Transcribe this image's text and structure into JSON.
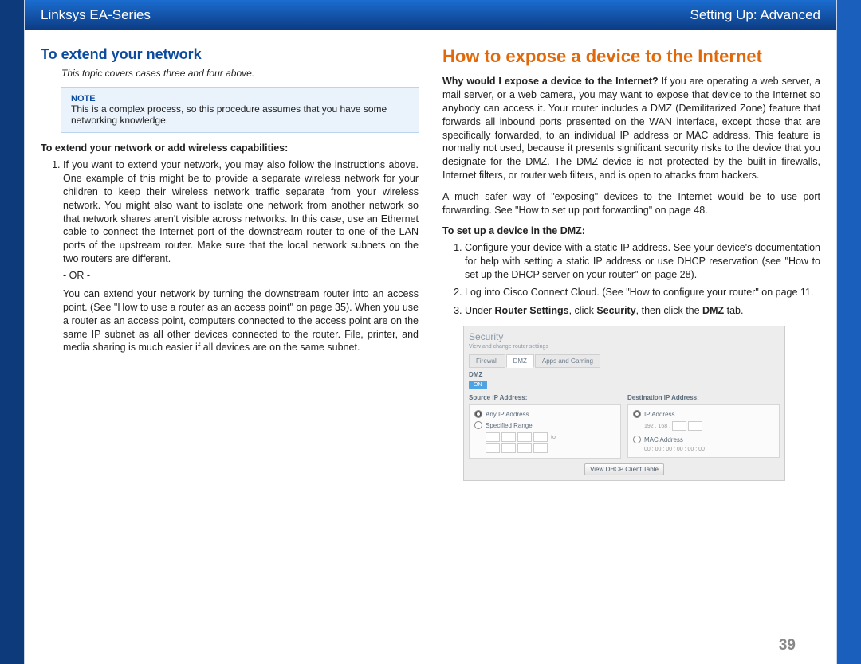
{
  "header": {
    "left": "Linksys EA-Series",
    "right": "Setting Up: Advanced"
  },
  "left": {
    "heading": "To extend your network",
    "subtitle": "This topic covers cases three and four above.",
    "note_label": "NOTE",
    "note_text": "This is a complex process, so this procedure assumes that you have some networking knowledge.",
    "bold_intro": "To extend your network or add wireless capabilities:",
    "step1": "If you want to extend your network, you may also follow the instructions above. One example of this might be to provide a separate wireless network for your children to keep their wireless network traffic separate from your wireless network. You might also want to isolate one network from another network so that network shares aren't visible across networks. In this case, use an Ethernet cable to connect the Internet port of the downstream router to one of the LAN ports of the upstream router. Make sure that the local network subnets on the two routers are different.",
    "or_text": "- OR -",
    "step1b": "You can extend your network by turning the downstream router into an access point. (See \"How to use a router as an access point\" on page 35). When you use a router as an access point, computers connected to the access point are on the same IP subnet as all other devices connected to the router. File, printer, and media sharing is much easier if all devices are on the same subnet."
  },
  "right": {
    "heading": "How to expose a device to the Internet",
    "para1_question": "Why would I expose a device to the Internet?",
    "para1_rest": " If you are operating a web server, a mail server, or a web camera, you may want to expose that device to the Internet so anybody can access it. Your router includes a DMZ (Demilitarized Zone) feature that forwards all inbound ports presented on the WAN interface, except those that are specifically forwarded, to an individual IP address or MAC address. This feature is normally not used, because it presents significant security risks to the device that you designate for the DMZ. The DMZ device is not protected by the built-in firewalls, Internet filters, or router web filters, and is open to attacks from hackers.",
    "para2": "A much safer way of \"exposing\" devices to the Internet would be to use port forwarding. See \"How to set up port forwarding\" on page 48.",
    "bold_intro": "To set up a device in the DMZ:",
    "step1": "Configure your device with a static IP address. See your device's documentation for help with setting a static IP address or use DHCP reservation (see \"How to set up the DHCP server on your router\" on page 28).",
    "step2": "Log into Cisco Connect Cloud. (See \"How to configure your router\" on page 11.",
    "step3_pre": "Under ",
    "step3_a": "Router Settings",
    "step3_b": ", click ",
    "step3_c": "Security",
    "step3_d": ", then click the ",
    "step3_e": "DMZ",
    "step3_f": " tab."
  },
  "screenshot": {
    "title": "Security",
    "sub": "View and change router settings",
    "tab1": "Firewall",
    "tab2": "DMZ",
    "tab3": "Apps and Gaming",
    "dmz_label": "DMZ",
    "toggle": "ON",
    "src_label": "Source IP Address:",
    "dst_label": "Destination IP Address:",
    "any_ip": "Any IP Address",
    "range": "Specified Range",
    "ip_addr": "IP Address",
    "ip_prefix": "192 . 168 .",
    "mac_addr": "MAC Address",
    "mac_val": "00 : 00 : 00 : 00 : 00 : 00",
    "to": "to",
    "btn": "View DHCP Client Table"
  },
  "page_number": "39"
}
